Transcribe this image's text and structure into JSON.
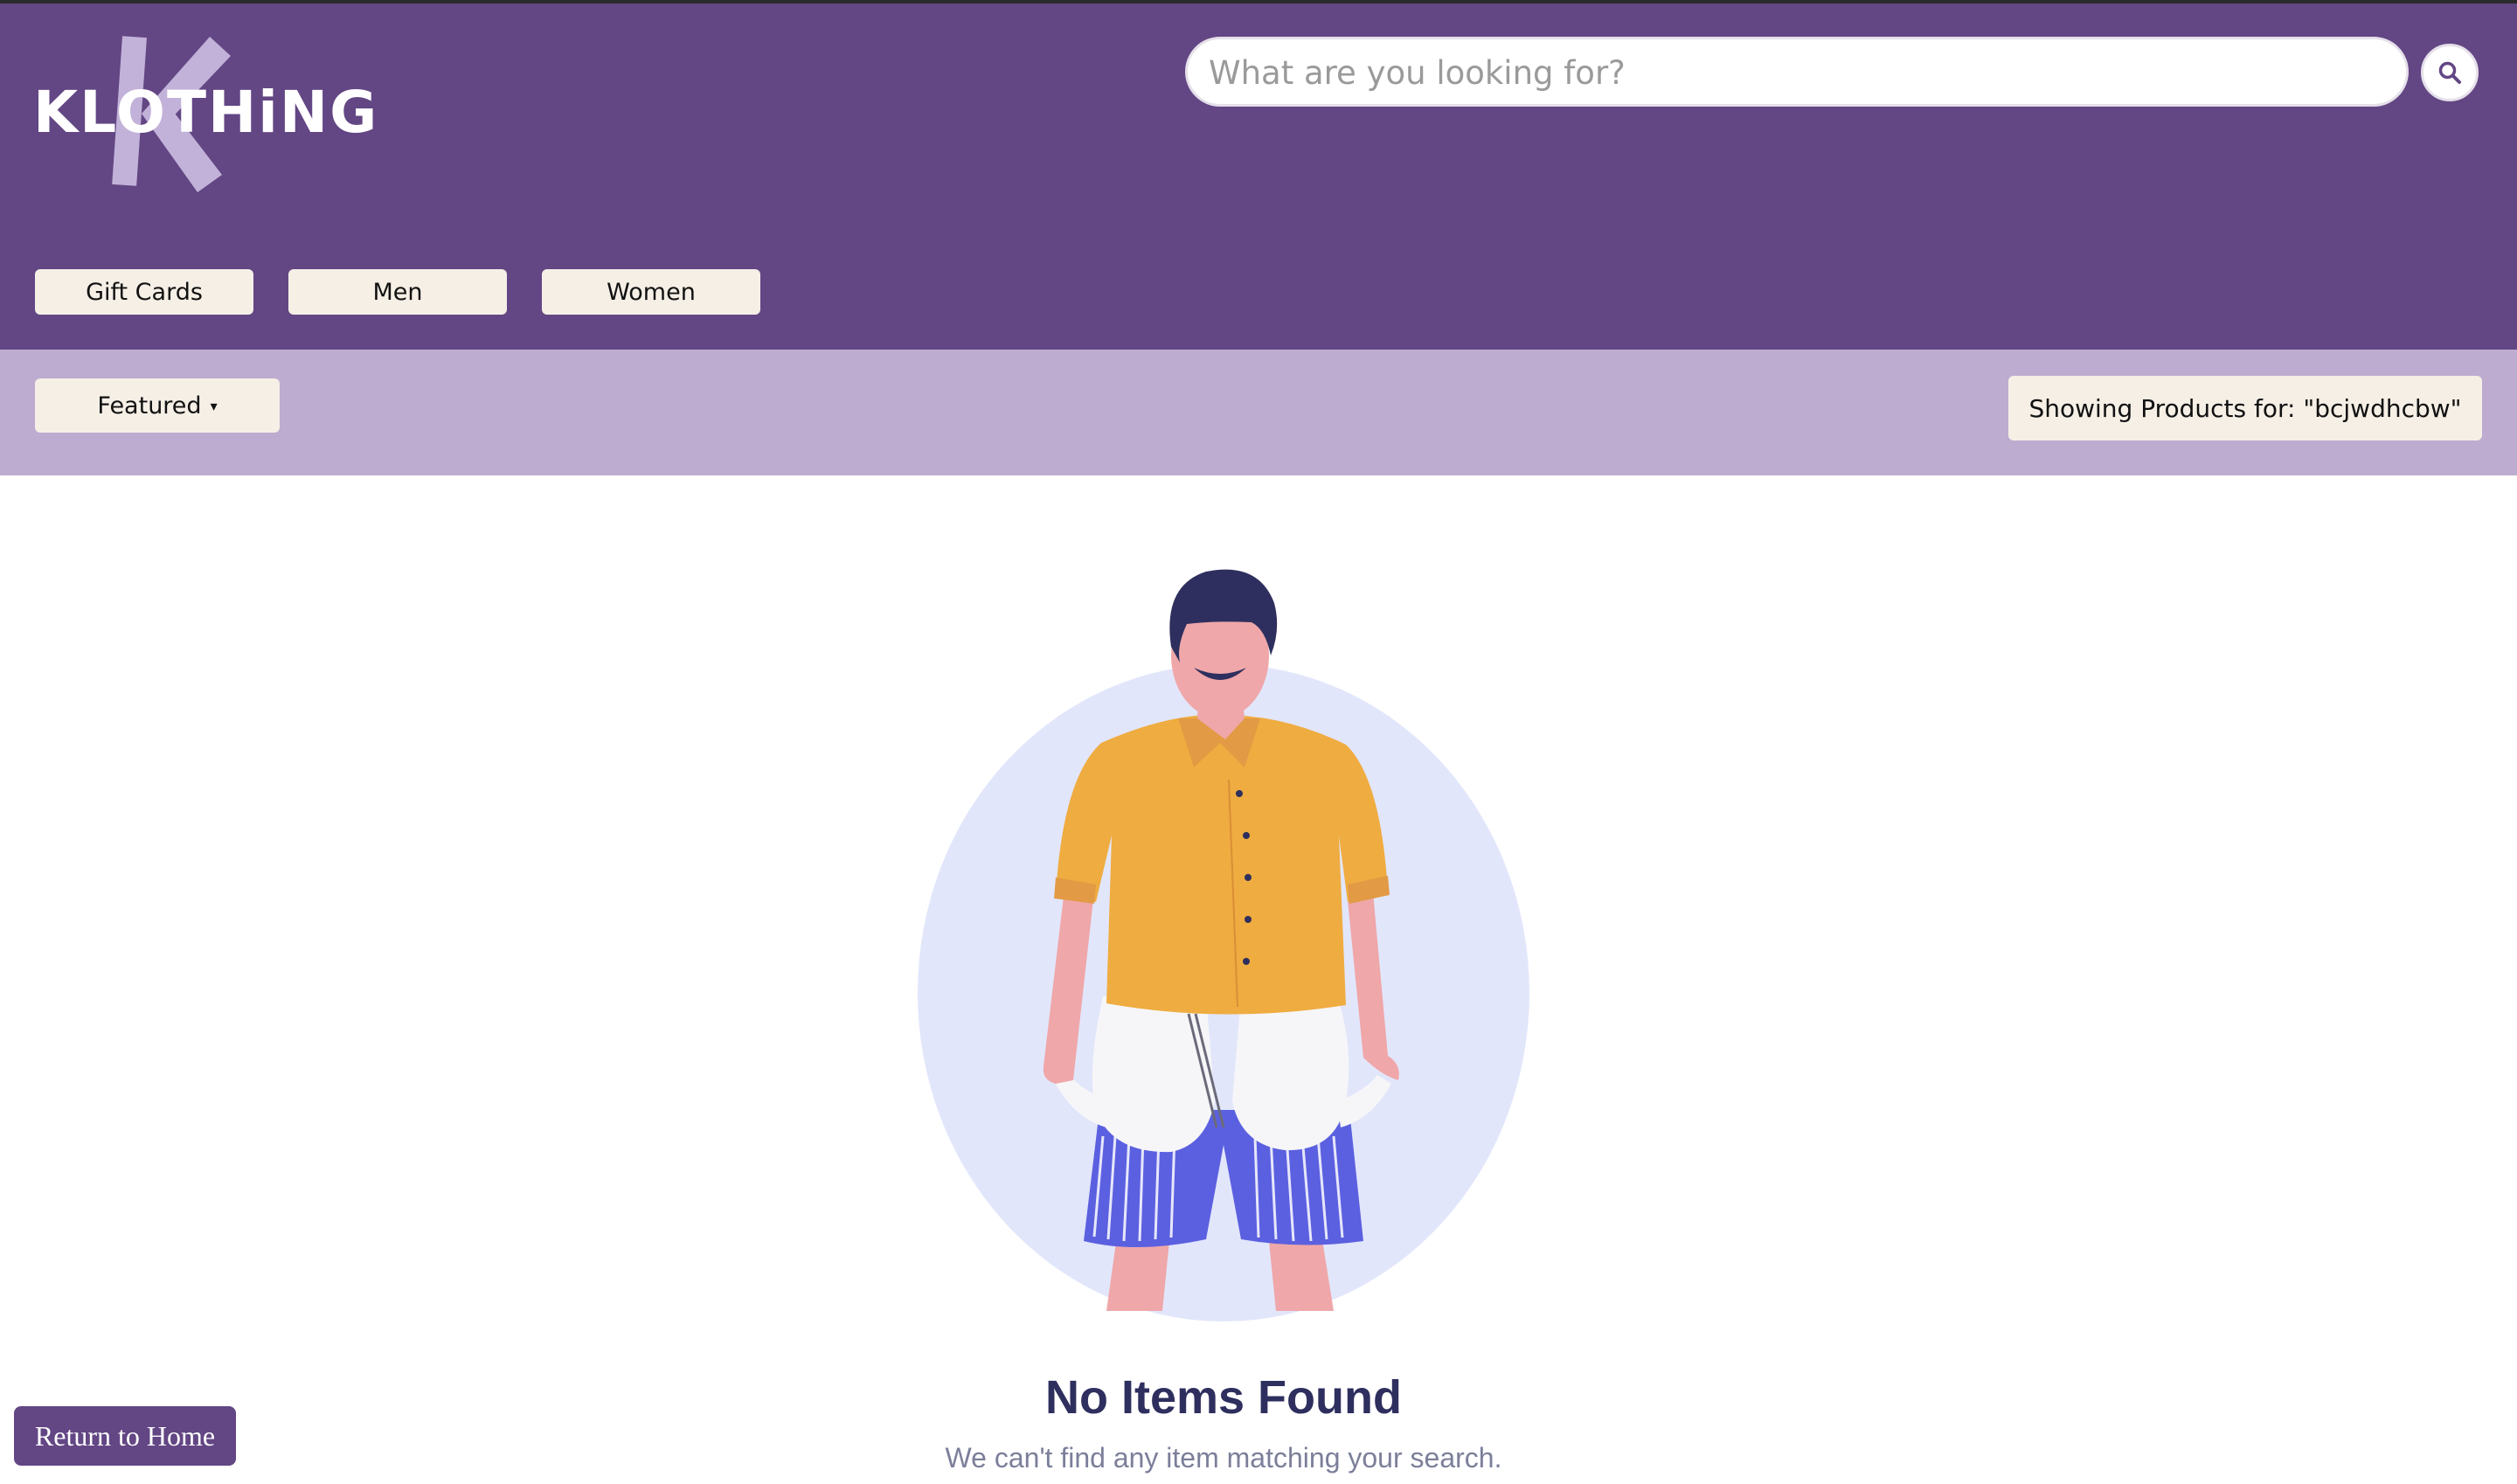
{
  "header": {
    "logo_text": "KLOTHiNG",
    "search": {
      "placeholder": "What are you looking for?",
      "value": ""
    },
    "search_button_icon": "search-icon",
    "categories": [
      {
        "label": "Gift Cards"
      },
      {
        "label": "Men"
      },
      {
        "label": "Women"
      }
    ]
  },
  "toolbar": {
    "sort_label": "Featured",
    "sort_caret": "▾",
    "showing_text": "Showing Products for: \"bcjwdhcbw\""
  },
  "empty_state": {
    "title": "No Items Found",
    "subtitle": "We can't find any item matching your search."
  },
  "footer": {
    "return_label": "Return to Home"
  },
  "colors": {
    "header_bg": "#634684",
    "subbar_bg": "#bdaccf",
    "button_bg": "#f5efe6",
    "title_color": "#2e2f5e",
    "illustration_circle": "#e2e6fb"
  }
}
